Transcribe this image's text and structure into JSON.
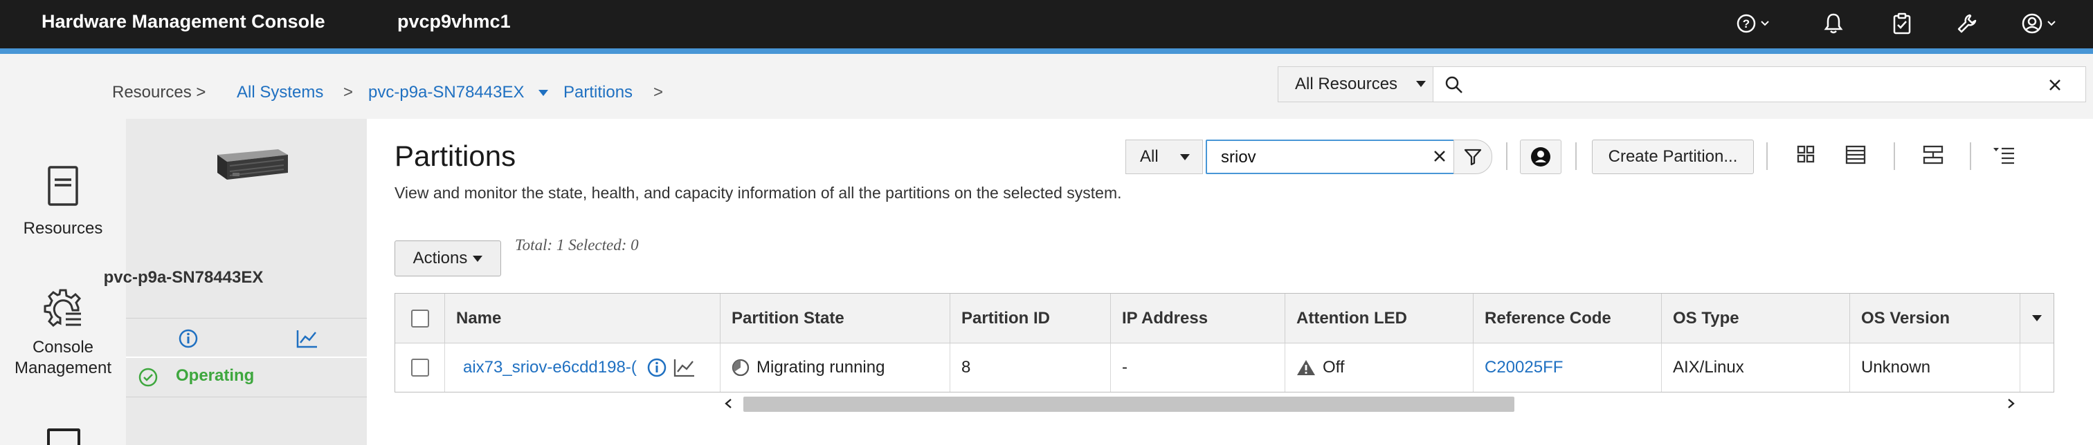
{
  "header": {
    "app_title": "Hardware Management Console",
    "host": "pvcp9vhmc1",
    "icons": [
      "help-icon",
      "notifications-icon",
      "tasks-icon",
      "wrench-icon",
      "user-icon"
    ]
  },
  "breadcrumb": {
    "root": "Resources >",
    "all_systems": "All Systems",
    "sep": ">",
    "system": "pvc-p9a-SN78443EX",
    "current": "Partitions"
  },
  "global_search": {
    "scope": "All Resources",
    "value": ""
  },
  "leftnav": {
    "items": [
      {
        "label": "Resources",
        "icon": "server-icon"
      },
      {
        "label": "Console\nManagement",
        "icon": "console-settings-icon"
      }
    ]
  },
  "system_panel": {
    "name": "pvc-p9a-SN78443EX",
    "status": "Operating",
    "status_color": "#3ea73e"
  },
  "page": {
    "title": "Partitions",
    "description": "View and monitor the state, health, and capacity information of all the partitions on the selected system.",
    "filter_scope": "All",
    "filter_value": "sriov",
    "create_button": "Create Partition...",
    "actions_button": "Actions",
    "summary": "Total: 1 Selected: 0"
  },
  "table": {
    "columns": [
      "Name",
      "Partition State",
      "Partition ID",
      "IP Address",
      "Attention LED",
      "Reference Code",
      "OS Type",
      "OS Version"
    ],
    "rows": [
      {
        "name": "aix73_sriov-e6cdd198-(",
        "state": "Migrating running",
        "id": "8",
        "ip": "-",
        "attention_led": "Off",
        "reference_code": "C20025FF",
        "os_type": "AIX/Linux",
        "os_version": "Unknown"
      }
    ]
  },
  "colors": {
    "accent": "#4896d6",
    "link": "#1f70c1",
    "topbar": "#1c1c1c"
  }
}
